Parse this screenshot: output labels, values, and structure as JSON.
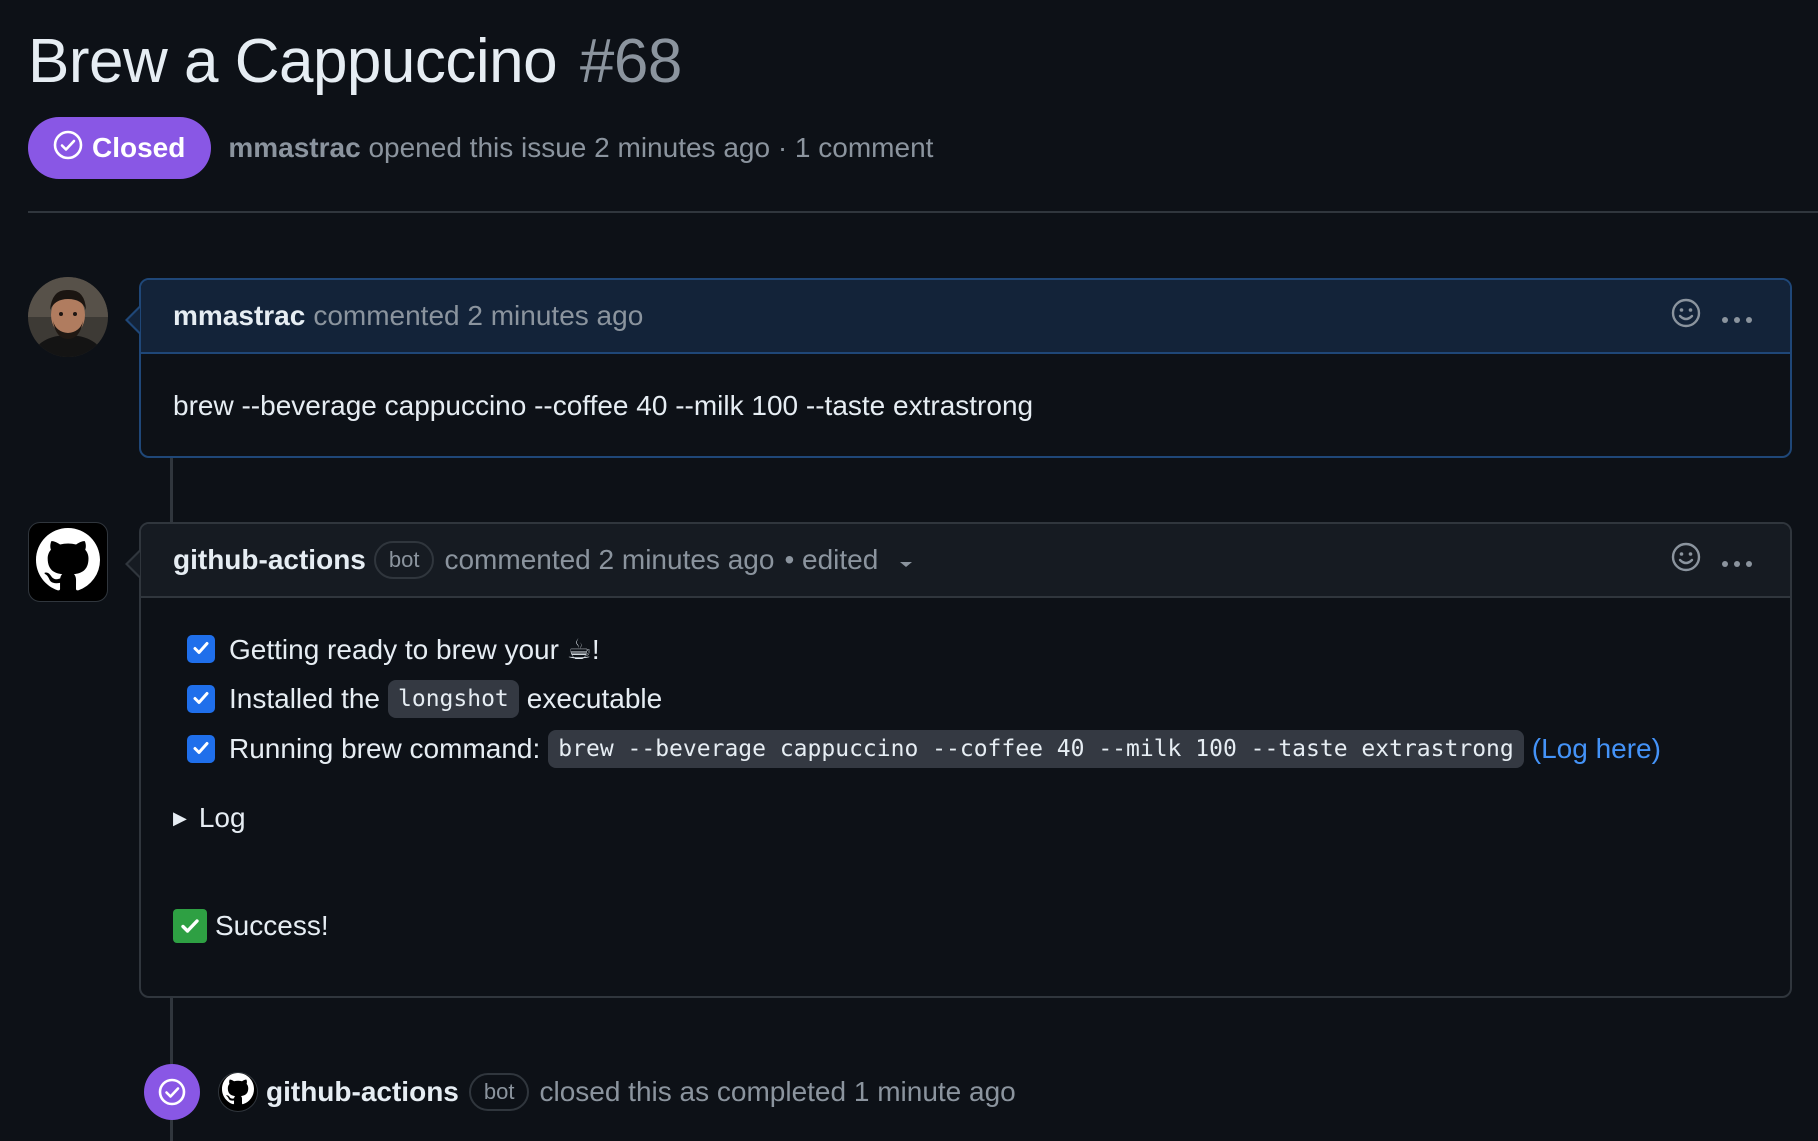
{
  "issue": {
    "title": "Brew a Cappuccino",
    "number": "#68",
    "state": "Closed",
    "author": "mmastrac",
    "meta": "opened this issue 2 minutes ago · 1 comment"
  },
  "comments": [
    {
      "author": "mmastrac",
      "meta": "commented 2 minutes ago",
      "body": "brew --beverage cappuccino --coffee 40 --milk 100 --taste extrastrong"
    },
    {
      "author": "github-actions",
      "badge": "bot",
      "meta": "commented 2 minutes ago",
      "edited": "• edited",
      "tasks": [
        {
          "text": "Getting ready to brew your ☕!"
        },
        {
          "pre": "Installed the",
          "code": "longshot",
          "post": "executable"
        },
        {
          "pre": "Running brew command:",
          "code": "brew --beverage cappuccino --coffee 40 --milk 100 --taste extrastrong",
          "link": "(Log here)"
        }
      ],
      "details_summary": "Log",
      "success": "Success!"
    }
  ],
  "event": {
    "author": "github-actions",
    "badge": "bot",
    "text": "closed this as completed 1 minute ago"
  },
  "colors": {
    "background": "#0d1117",
    "closed_purple": "#8957e5",
    "link_blue": "#4493f8",
    "checkbox_blue": "#1f6feb"
  },
  "icons": [
    "check-circle-icon",
    "smiley-icon",
    "kebab-icon",
    "github-mark-icon",
    "chevron-down-icon",
    "checkmark-icon",
    "triangle-right-icon"
  ]
}
